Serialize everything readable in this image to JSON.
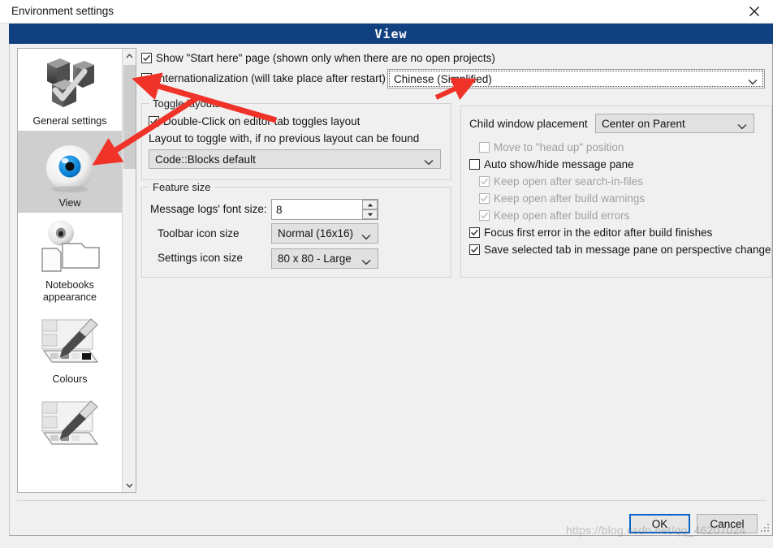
{
  "window": {
    "title": "Environment settings",
    "close_icon": "close-icon",
    "header_title": "View"
  },
  "sidebar": {
    "items": [
      {
        "label": "General settings",
        "icon": "blocks-check-icon",
        "selected": false
      },
      {
        "label": "View",
        "icon": "eyeball-icon",
        "selected": true
      },
      {
        "label": "Notebooks appearance",
        "icon": "eye-folders-icon",
        "selected": false
      },
      {
        "label": "Colours",
        "icon": "brush-palette-icon",
        "selected": false
      },
      {
        "label": "",
        "icon": "brush-palette-icon",
        "selected": false
      }
    ],
    "scroll_up_icon": "chevron-up-icon",
    "scroll_down_icon": "chevron-down-icon"
  },
  "main": {
    "show_start_here": {
      "label": "Show \"Start here\" page (shown only when there are no open projects)",
      "checked": true
    },
    "internationalization": {
      "label": "Internationalization (will take place after restart)",
      "checked": true
    },
    "language_combo": {
      "value": "Chinese (Simplified)",
      "arrow_icon": "chevron-down-icon"
    },
    "toggle_layouts": {
      "title": "Toggle layouts",
      "double_click": {
        "label": "Double-Click on editor tab toggles layout",
        "checked": true
      },
      "hint": "Layout to toggle with, if no previous layout can be found",
      "layout_combo": {
        "value": "Code::Blocks default",
        "arrow_icon": "chevron-down-icon"
      }
    },
    "feature_size": {
      "title": "Feature size",
      "message_logs_font_label": "Message logs' font size:",
      "message_logs_font_value": "8",
      "spin_up_icon": "triangle-up-icon",
      "spin_down_icon": "triangle-down-icon",
      "toolbar_icon_label": "Toolbar icon size",
      "toolbar_icon_value": "Normal (16x16)",
      "settings_icon_label": "Settings icon size",
      "settings_icon_value": "80 x 80 - Large"
    },
    "right_panel": {
      "child_window_label": "Child window placement",
      "child_window_value": "Center on Parent",
      "options": [
        {
          "label": "Move to \"head up\" position",
          "checked": false,
          "disabled": true
        },
        {
          "label": "Auto show/hide message pane",
          "checked": false,
          "disabled": false
        },
        {
          "label": "Keep open after search-in-files",
          "checked": true,
          "disabled": true
        },
        {
          "label": "Keep open after build warnings",
          "checked": true,
          "disabled": true
        },
        {
          "label": "Keep open after build errors",
          "checked": true,
          "disabled": true
        },
        {
          "label": "Focus first error in the editor after build finishes",
          "checked": true,
          "disabled": false
        },
        {
          "label": "Save selected tab in message pane on perspective change",
          "checked": true,
          "disabled": false
        }
      ]
    }
  },
  "footer": {
    "ok_label": "OK",
    "cancel_label": "Cancel"
  },
  "watermark": {
    "text": "https://blog.csdn.net/qq_46207024"
  },
  "colors": {
    "header_band": "#10407f",
    "dialog_bg": "#f0f0f0",
    "annotation_arrow": "#f03328",
    "default_button_border": "#0a64c8"
  }
}
